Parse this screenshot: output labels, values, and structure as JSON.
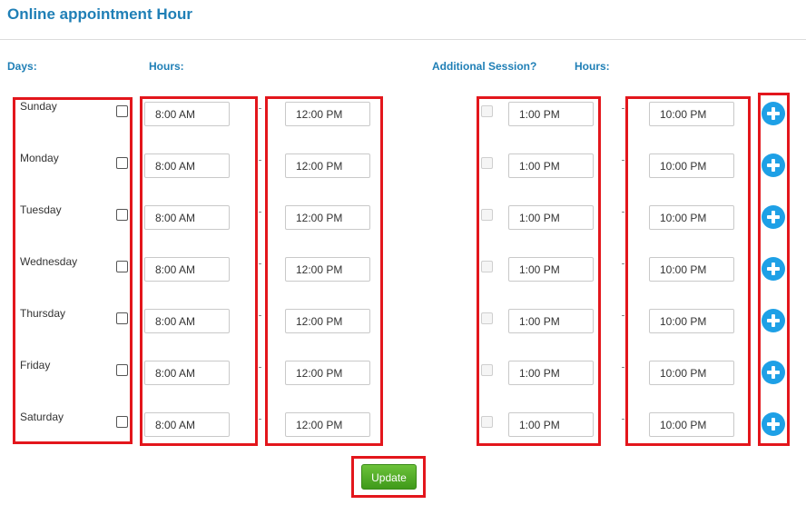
{
  "page": {
    "title": "Online appointment Hour",
    "days_label": "Days:",
    "hours_label": "Hours:",
    "additional_label": "Additional Session?",
    "hours_label_2": "Hours:",
    "update_label": "Update"
  },
  "rows": [
    {
      "day": "Sunday",
      "from": "8:00 AM",
      "to": "12:00 PM",
      "add_from": "1:00 PM",
      "add_to": "10:00 PM"
    },
    {
      "day": "Monday",
      "from": "8:00 AM",
      "to": "12:00 PM",
      "add_from": "1:00 PM",
      "add_to": "10:00 PM"
    },
    {
      "day": "Tuesday",
      "from": "8:00 AM",
      "to": "12:00 PM",
      "add_from": "1:00 PM",
      "add_to": "10:00 PM"
    },
    {
      "day": "Wednesday",
      "from": "8:00 AM",
      "to": "12:00 PM",
      "add_from": "1:00 PM",
      "add_to": "10:00 PM"
    },
    {
      "day": "Thursday",
      "from": "8:00 AM",
      "to": "12:00 PM",
      "add_from": "1:00 PM",
      "add_to": "10:00 PM"
    },
    {
      "day": "Friday",
      "from": "8:00 AM",
      "to": "12:00 PM",
      "add_from": "1:00 PM",
      "add_to": "10:00 PM"
    },
    {
      "day": "Saturday",
      "from": "8:00 AM",
      "to": "12:00 PM",
      "add_from": "1:00 PM",
      "add_to": "10:00 PM"
    }
  ],
  "colors": {
    "heading": "#1f7fb6",
    "highlight_box": "#e3161c",
    "add_button": "#1ea0e6",
    "update_button": "#4caf26"
  },
  "icons": {
    "add_session": "plus-circle-icon"
  }
}
